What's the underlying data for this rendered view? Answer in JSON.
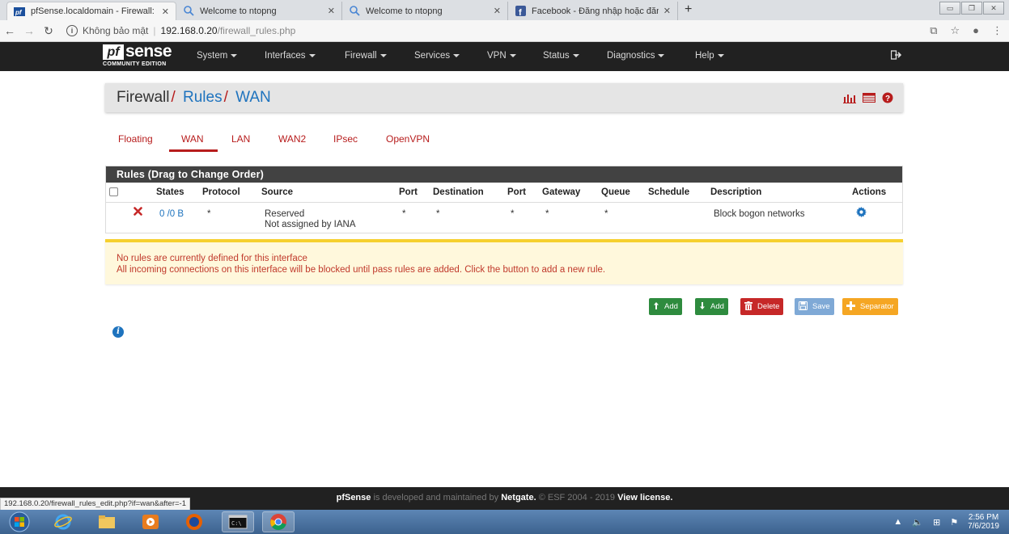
{
  "browser": {
    "tabs": [
      {
        "title": "pfSense.localdomain - Firewall: R",
        "icon": "pfsense-favicon",
        "active": true
      },
      {
        "title": "Welcome to ntopng",
        "icon": "search-icon"
      },
      {
        "title": "Welcome to ntopng",
        "icon": "search-icon"
      },
      {
        "title": "Facebook - Đăng nhập hoặc đăn",
        "icon": "facebook-icon"
      }
    ],
    "close_glyph": "✕",
    "new_tab_glyph": "+",
    "security_label": "Không bảo mật",
    "url_host": "192.168.0.20",
    "url_path": "/firewall_rules.php",
    "status_url": "192.168.0.20/firewall_rules_edit.php?if=wan&after=-1"
  },
  "navbar": {
    "logo_pf": "pf",
    "logo_sense": "sense",
    "logo_edition": "COMMUNITY EDITION",
    "menu": [
      "System",
      "Interfaces",
      "Firewall",
      "Services",
      "VPN",
      "Status",
      "Diagnostics",
      "Help"
    ]
  },
  "breadcrumb": {
    "root": "Firewall",
    "level1": "Rules",
    "level2": "WAN",
    "separator": "/"
  },
  "tabs": [
    "Floating",
    "WAN",
    "LAN",
    "WAN2",
    "IPsec",
    "OpenVPN"
  ],
  "active_tab": "WAN",
  "rules_panel": {
    "title": "Rules (Drag to Change Order)",
    "columns": [
      "States",
      "Protocol",
      "Source",
      "Port",
      "Destination",
      "Port",
      "Gateway",
      "Queue",
      "Schedule",
      "Description",
      "Actions"
    ],
    "rows": [
      {
        "states": "0 /0 B",
        "protocol": "*",
        "source_line1": "Reserved",
        "source_line2": "Not assigned by IANA",
        "port": "*",
        "destination": "*",
        "dest_port": "*",
        "gateway": "*",
        "queue": "*",
        "schedule": "",
        "description": "Block bogon networks"
      }
    ]
  },
  "alert": {
    "line1": "No rules are currently defined for this interface",
    "line2": "All incoming connections on this interface will be blocked until pass rules are added. Click the button to add a new rule."
  },
  "buttons": {
    "add_top": "Add",
    "add_bottom": "Add",
    "delete": "Delete",
    "save": "Save",
    "separator": "Separator"
  },
  "footer": {
    "brand": "pfSense",
    "text1": " is developed and maintained by ",
    "company": "Netgate.",
    "text2": " © ESF 2004 - 2019 ",
    "license": "View license."
  },
  "taskbar": {
    "time": "2:56 PM",
    "date": "7/6/2019"
  },
  "colors": {
    "accent_red": "#b71c1c",
    "link_blue": "#1e73be",
    "nav_dark": "#212121",
    "btn_green": "#2e8b3e",
    "btn_red": "#c62828",
    "alert_bg": "#fff8dc"
  }
}
